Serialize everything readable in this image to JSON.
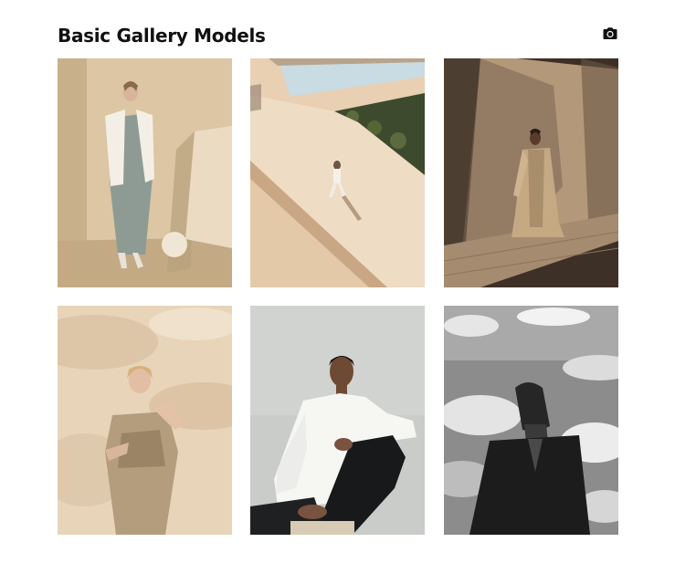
{
  "gallery": {
    "title": "Basic Gallery Models",
    "camera_icon": "camera-icon",
    "items": [
      {
        "name": "photo-model-grey-dress",
        "subject": "model-in-grey-dress-and-white-jacket"
      },
      {
        "name": "photo-rooftop-walker",
        "subject": "person-walking-on-sunlit-rooftop"
      },
      {
        "name": "photo-trench-coat-wall",
        "subject": "model-in-trench-coat-by-concrete-wall"
      },
      {
        "name": "photo-beige-outfit",
        "subject": "model-in-beige-outfit-with-shadows"
      },
      {
        "name": "photo-white-shirt-seated",
        "subject": "seated-model-in-white-shirt"
      },
      {
        "name": "photo-sky-black-shirt",
        "subject": "black-and-white-model-against-sky"
      }
    ]
  },
  "colors": {
    "background": "#ffffff",
    "title": "#111111"
  }
}
